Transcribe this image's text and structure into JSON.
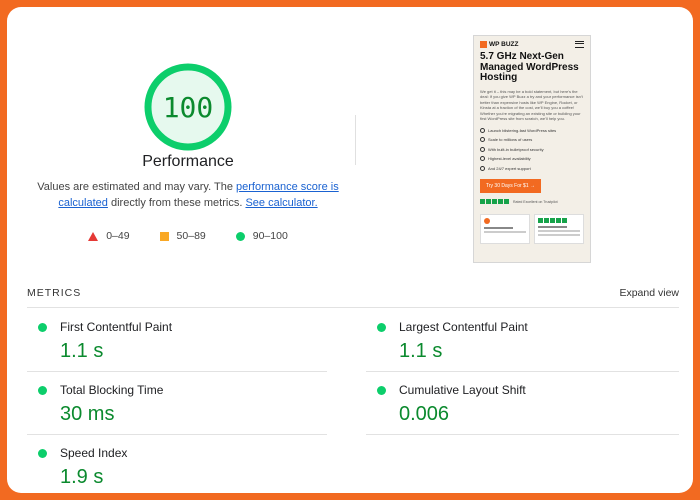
{
  "performance": {
    "score": "100",
    "title": "Performance",
    "desc_pre": "Values are estimated and may vary. The ",
    "desc_link1": "performance score is calculated",
    "desc_mid": " directly from these metrics. ",
    "desc_link2": "See calculator.",
    "score_color": "#0cce6b"
  },
  "legend": [
    {
      "shape": "triangle",
      "range": "0–49",
      "color": "#e53935"
    },
    {
      "shape": "square",
      "range": "50–89",
      "color": "#f9a825"
    },
    {
      "shape": "circle",
      "range": "90–100",
      "color": "#0cce6b"
    }
  ],
  "thumbnail": {
    "logo": "WP BUZZ",
    "hero": "5.7 GHz Next-Gen Managed WordPress Hosting",
    "body": "We get it – this may be a bold statement, but here's the deal: If you give WP Buzz a try and your performance isn't better than expensive hosts like WP Engine, Rocket, or Kinsta at a fraction of the cost, we'll buy you a coffee! Whether you're migrating an existing site or building your first WordPress site from scratch, we'll help you.",
    "bullets": [
      "Launch blistering-fast WordPress sites",
      "Scale to millions of users",
      "With built-in bulletproof security",
      "Highest-level availability",
      "And 24/7 expert support"
    ],
    "cta": "Try 30 Days For $1 →",
    "rating": "Rated Excellent on Trustpilot"
  },
  "metrics": {
    "label": "METRICS",
    "expand": "Expand view",
    "items": [
      {
        "name": "First Contentful Paint",
        "value": "1.1 s"
      },
      {
        "name": "Largest Contentful Paint",
        "value": "1.1 s"
      },
      {
        "name": "Total Blocking Time",
        "value": "30 ms"
      },
      {
        "name": "Cumulative Layout Shift",
        "value": "0.006"
      },
      {
        "name": "Speed Index",
        "value": "1.9 s"
      }
    ]
  },
  "colors": {
    "frame": "#f26a21",
    "pass_green": "#0cce6b",
    "value_green": "#0b8a2e",
    "link": "#1a62d1"
  }
}
